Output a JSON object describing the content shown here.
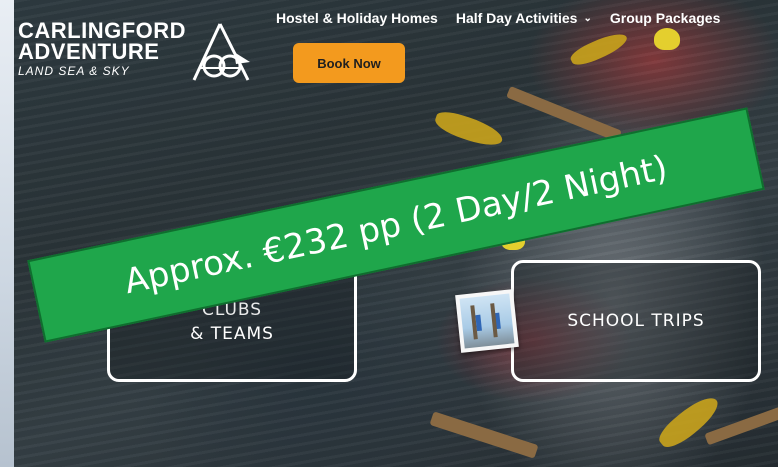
{
  "logo": {
    "line1": "CARLINGFORD",
    "line2": "ADVENTURE",
    "tagline": "LAND SEA & SKY"
  },
  "nav": {
    "items": [
      {
        "label": "Hostel & Holiday Homes"
      },
      {
        "label": "Half Day Activities",
        "has_dropdown": true
      },
      {
        "label": "Group Packages"
      }
    ],
    "chevron": "⌄"
  },
  "cta": {
    "book_label": "Book Now",
    "color": "#f39a1e"
  },
  "cards": {
    "clubs_line1": "CLUBS",
    "clubs_line2": "& TEAMS",
    "school_label": "SCHOOL TRIPS"
  },
  "banner": {
    "text": "Approx. €232 pp (2 Day/2 Night)",
    "color": "#1fa64b"
  }
}
